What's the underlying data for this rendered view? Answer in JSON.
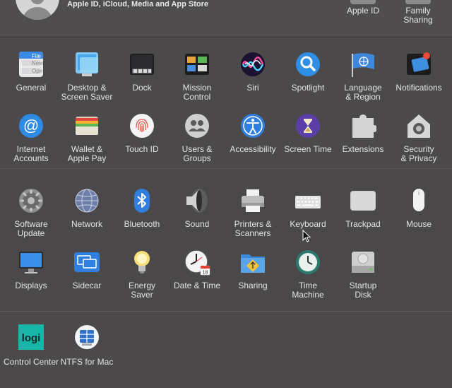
{
  "account": {
    "subtitle": "Apple ID, iCloud, Media and App Store",
    "top_items": [
      {
        "label": "Apple ID"
      },
      {
        "label": "Family\nSharing"
      }
    ]
  },
  "sections": [
    {
      "panes": [
        {
          "id": "general",
          "label": "General",
          "icon": "general-icon"
        },
        {
          "id": "desktop",
          "label": "Desktop &\nScreen Saver",
          "icon": "desktop-icon"
        },
        {
          "id": "dock",
          "label": "Dock",
          "icon": "dock-icon"
        },
        {
          "id": "mission",
          "label": "Mission\nControl",
          "icon": "mission-control-icon"
        },
        {
          "id": "siri",
          "label": "Siri",
          "icon": "siri-icon"
        },
        {
          "id": "spotlight",
          "label": "Spotlight",
          "icon": "spotlight-icon"
        },
        {
          "id": "language",
          "label": "Language\n& Region",
          "icon": "language-icon"
        },
        {
          "id": "notifications",
          "label": "Notifications",
          "icon": "notifications-icon"
        },
        {
          "id": "internet",
          "label": "Internet\nAccounts",
          "icon": "internet-accounts-icon"
        },
        {
          "id": "wallet",
          "label": "Wallet &\nApple Pay",
          "icon": "wallet-icon"
        },
        {
          "id": "touchid",
          "label": "Touch ID",
          "icon": "touch-id-icon"
        },
        {
          "id": "users",
          "label": "Users &\nGroups",
          "icon": "users-icon"
        },
        {
          "id": "accessibility",
          "label": "Accessibility",
          "icon": "accessibility-icon"
        },
        {
          "id": "screentime",
          "label": "Screen Time",
          "icon": "screen-time-icon"
        },
        {
          "id": "extensions",
          "label": "Extensions",
          "icon": "extensions-icon"
        },
        {
          "id": "security",
          "label": "Security\n& Privacy",
          "icon": "security-icon"
        }
      ]
    },
    {
      "panes": [
        {
          "id": "software",
          "label": "Software\nUpdate",
          "icon": "software-update-icon"
        },
        {
          "id": "network",
          "label": "Network",
          "icon": "network-icon"
        },
        {
          "id": "bluetooth",
          "label": "Bluetooth",
          "icon": "bluetooth-icon"
        },
        {
          "id": "sound",
          "label": "Sound",
          "icon": "sound-icon"
        },
        {
          "id": "printers",
          "label": "Printers &\nScanners",
          "icon": "printer-icon"
        },
        {
          "id": "keyboard",
          "label": "Keyboard",
          "icon": "keyboard-icon"
        },
        {
          "id": "trackpad",
          "label": "Trackpad",
          "icon": "trackpad-icon"
        },
        {
          "id": "mouse",
          "label": "Mouse",
          "icon": "mouse-icon"
        },
        {
          "id": "displays",
          "label": "Displays",
          "icon": "displays-icon"
        },
        {
          "id": "sidecar",
          "label": "Sidecar",
          "icon": "sidecar-icon"
        },
        {
          "id": "energy",
          "label": "Energy\nSaver",
          "icon": "energy-saver-icon"
        },
        {
          "id": "datetime",
          "label": "Date & Time",
          "icon": "date-time-icon",
          "calendar_day": "18"
        },
        {
          "id": "sharing",
          "label": "Sharing",
          "icon": "sharing-icon"
        },
        {
          "id": "timemachine",
          "label": "Time\nMachine",
          "icon": "time-machine-icon"
        },
        {
          "id": "startup",
          "label": "Startup\nDisk",
          "icon": "startup-disk-icon"
        }
      ]
    },
    {
      "panes": [
        {
          "id": "logi",
          "label": "Control Center",
          "icon": "logi-icon",
          "icon_text": "logi"
        },
        {
          "id": "ntfs",
          "label": "NTFS for Mac",
          "icon": "ntfs-icon"
        }
      ]
    }
  ],
  "general_icon_text": [
    "File",
    "New",
    "Ope"
  ],
  "colors": {
    "background": "#4a4849",
    "label": "#e4e4e4",
    "accent_blue": "#2f7fe0"
  }
}
